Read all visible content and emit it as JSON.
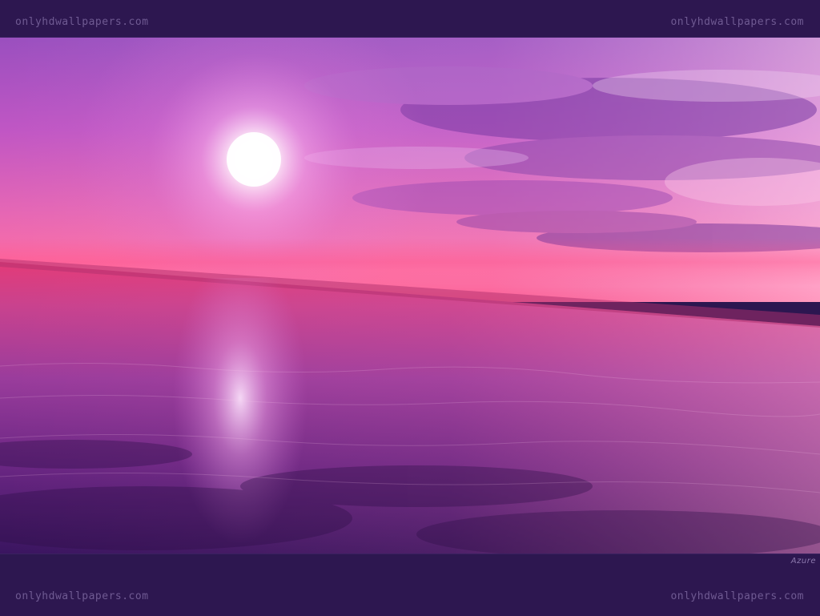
{
  "watermarks": {
    "top_left": "onlyhdwallpapers.com",
    "top_right": "onlyhdwallpapers.com",
    "bottom_left": "onlyhdwallpapers.com",
    "bottom_right": "onlyhdwallpapers.com"
  },
  "credit": "Azure",
  "colors": {
    "frame": "#2d1750",
    "sky_top": "#a64ec2",
    "sky_horizon": "#ff5a9a",
    "sea_near": "#3e1660",
    "sun": "#ffffff"
  }
}
